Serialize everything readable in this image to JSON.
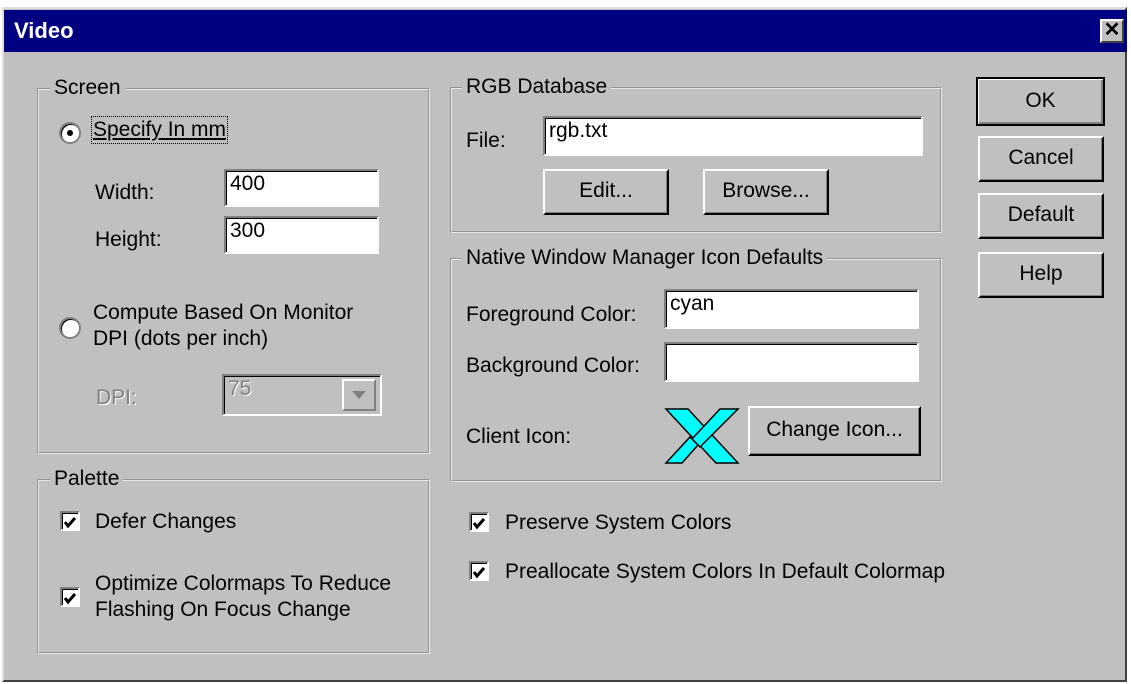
{
  "window": {
    "title": "Video",
    "close_glyph": "✕"
  },
  "screen": {
    "label": "Screen",
    "specify": {
      "label": "Specify In mm",
      "selected": true
    },
    "width": {
      "label": "Width:",
      "value": "400"
    },
    "height": {
      "label": "Height:",
      "value": "300"
    },
    "compute": {
      "label_line1": "Compute Based On Monitor",
      "label_line2": "DPI (dots per inch)",
      "selected": false
    },
    "dpi": {
      "label": "DPI:",
      "value": "75",
      "enabled": false
    }
  },
  "palette": {
    "label": "Palette",
    "defer": {
      "label": "Defer Changes",
      "checked": true
    },
    "optimize": {
      "label_line1": "Optimize Colormaps To Reduce",
      "label_line2": "Flashing On Focus Change",
      "checked": true
    }
  },
  "rgb": {
    "label": "RGB Database",
    "file": {
      "label": "File:",
      "value": "rgb.txt"
    },
    "edit_button": "Edit...",
    "browse_button": "Browse..."
  },
  "native": {
    "label": "Native Window Manager Icon Defaults",
    "fg": {
      "label": "Foreground Color:",
      "value": "cyan"
    },
    "bg": {
      "label": "Background Color:",
      "value": ""
    },
    "client_icon": {
      "label": "Client Icon:",
      "icon": "x-logo-icon",
      "color": "#00ffff"
    },
    "change_icon_button": "Change Icon..."
  },
  "preserve": {
    "label": "Preserve System Colors",
    "checked": true
  },
  "preallocate": {
    "label": "Preallocate System Colors In Default Colormap",
    "checked": true
  },
  "buttons": {
    "ok": "OK",
    "cancel": "Cancel",
    "default": "Default",
    "help": "Help"
  }
}
